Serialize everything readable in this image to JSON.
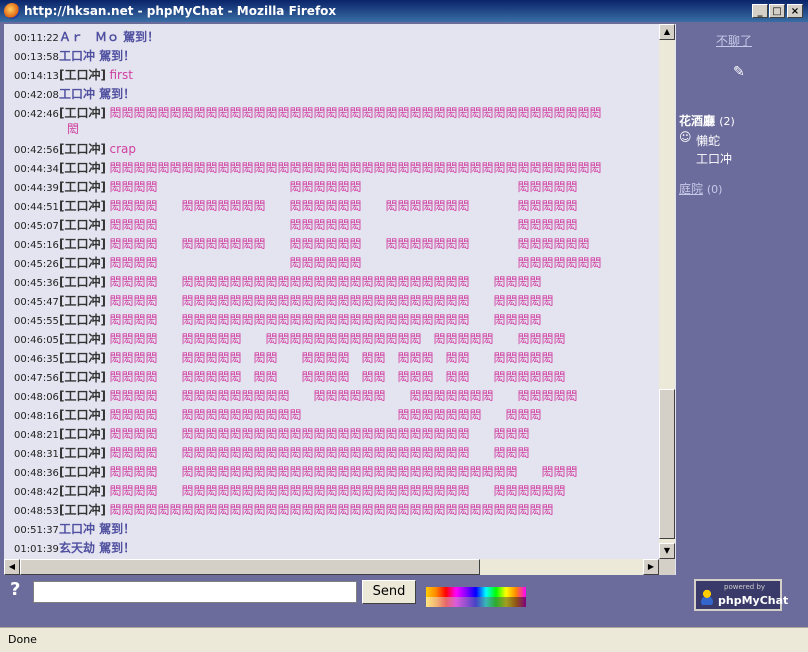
{
  "window": {
    "title": "http://hksan.net - phpMyChat - Mozilla Firefox"
  },
  "messages": [
    {
      "time": "00:11:22",
      "sys": "Ａｒ　Ｍｏ 駕到！"
    },
    {
      "time": "00:13:58",
      "sys": "工口冲 駕到！"
    },
    {
      "time": "00:14:13",
      "nick": "[工口冲]",
      "text": "first"
    },
    {
      "time": "00:42:08",
      "sys": "工口冲 駕到！"
    },
    {
      "time": "00:42:46",
      "nick": "[工口冲]",
      "text": "閎閎閎閎閎閎閎閎閎閎閎閎閎閎閎閎閎閎閎閎閎閎閎閎閎閎閎閎閎閎閎閎閎閎閎閎閎閎閎閎閎",
      "text2": "閎"
    },
    {
      "time": "00:42:56",
      "nick": "[工口冲]",
      "text": "crap"
    },
    {
      "time": "00:44:34",
      "nick": "[工口冲]",
      "text": "閎閎閎閎閎閎閎閎閎閎閎閎閎閎閎閎閎閎閎閎閎閎閎閎閎閎閎閎閎閎閎閎閎閎閎閎閎閎閎閎閎"
    },
    {
      "time": "00:44:39",
      "nick": "[工口冲]",
      "text": "閎閎閎閎　　　　　　　　　　　閎閎閎閎閎閎　　　　　　　　　　　　　閎閎閎閎閎"
    },
    {
      "time": "00:44:51",
      "nick": "[工口冲]",
      "text": "閎閎閎閎　　閎閎閎閎閎閎閎　　閎閎閎閎閎閎　　閎閎閎閎閎閎閎　　　　閎閎閎閎閎"
    },
    {
      "time": "00:45:07",
      "nick": "[工口冲]",
      "text": "閎閎閎閎　　　　　　　　　　　閎閎閎閎閎閎　　　　　　　　　　　　　閎閎閎閎閎"
    },
    {
      "time": "00:45:16",
      "nick": "[工口冲]",
      "text": "閎閎閎閎　　閎閎閎閎閎閎閎　　閎閎閎閎閎閎　　閎閎閎閎閎閎閎　　　　閎閎閎閎閎閎"
    },
    {
      "time": "00:45:26",
      "nick": "[工口冲]",
      "text": "閎閎閎閎　　　　　　　　　　　閎閎閎閎閎閎　　　　　　　　　　　　　閎閎閎閎閎閎閎"
    },
    {
      "time": "00:45:36",
      "nick": "[工口冲]",
      "text": "閎閎閎閎　　閎閎閎閎閎閎閎閎閎閎閎閎閎閎閎閎閎閎閎閎閎閎閎閎　　閎閎閎閎"
    },
    {
      "time": "00:45:47",
      "nick": "[工口冲]",
      "text": "閎閎閎閎　　閎閎閎閎閎閎閎閎閎閎閎閎閎閎閎閎閎閎閎閎閎閎閎閎　　閎閎閎閎閎"
    },
    {
      "time": "00:45:55",
      "nick": "[工口冲]",
      "text": "閎閎閎閎　　閎閎閎閎閎閎閎閎閎閎閎閎閎閎閎閎閎閎閎閎閎閎閎閎　　閎閎閎閎"
    },
    {
      "time": "00:46:05",
      "nick": "[工口冲]",
      "text": "閎閎閎閎　　閎閎閎閎閎　　閎閎閎閎閎閎閎閎閎閎閎閎閎　閎閎閎閎閎　　閎閎閎閎"
    },
    {
      "time": "00:46:35",
      "nick": "[工口冲]",
      "text": "閎閎閎閎　　閎閎閎閎閎　閎閎　　閎閎閎閎　閎閎　閎閎閎　閎閎　　閎閎閎閎閎"
    },
    {
      "time": "00:47:56",
      "nick": "[工口冲]",
      "text": "閎閎閎閎　　閎閎閎閎閎　閎閎　　閎閎閎閎　閎閎　閎閎閎　閎閎　　閎閎閎閎閎閎"
    },
    {
      "time": "00:48:06",
      "nick": "[工口冲]",
      "text": "閎閎閎閎　　閎閎閎閎閎閎閎閎閎　　閎閎閎閎閎閎　　閎閎閎閎閎閎閎　　閎閎閎閎閎"
    },
    {
      "time": "00:48:16",
      "nick": "[工口冲]",
      "text": "閎閎閎閎　　閎閎閎閎閎閎閎閎閎閎　　　　　　　　閎閎閎閎閎閎閎　　閎閎閎"
    },
    {
      "time": "00:48:21",
      "nick": "[工口冲]",
      "text": "閎閎閎閎　　閎閎閎閎閎閎閎閎閎閎閎閎閎閎閎閎閎閎閎閎閎閎閎閎　　閎閎閎"
    },
    {
      "time": "00:48:31",
      "nick": "[工口冲]",
      "text": "閎閎閎閎　　閎閎閎閎閎閎閎閎閎閎閎閎閎閎閎閎閎閎閎閎閎閎閎閎　　閎閎閎"
    },
    {
      "time": "00:48:36",
      "nick": "[工口冲]",
      "text": "閎閎閎閎　　閎閎閎閎閎閎閎閎閎閎閎閎閎閎閎閎閎閎閎閎閎閎閎閎閎閎閎閎　　閎閎閎"
    },
    {
      "time": "00:48:42",
      "nick": "[工口冲]",
      "text": "閎閎閎閎　　閎閎閎閎閎閎閎閎閎閎閎閎閎閎閎閎閎閎閎閎閎閎閎閎　　閎閎閎閎閎閎"
    },
    {
      "time": "00:48:53",
      "nick": "[工口冲]",
      "text": "閎閎閎閎閎閎閎閎閎閎閎閎閎閎閎閎閎閎閎閎閎閎閎閎閎閎閎閎閎閎閎閎閎閎閎閎閎"
    },
    {
      "time": "00:51:37",
      "sys": "工口冲 駕到！"
    },
    {
      "time": "01:01:39",
      "sys": "玄天劫 駕到！"
    }
  ],
  "sidebar": {
    "leave_label": "不聊了",
    "room1": {
      "name": "花酒廳",
      "count": "(2)",
      "users": [
        "懶蛇",
        "工口冲"
      ]
    },
    "room2": {
      "name": "庭院",
      "count": "(0)"
    }
  },
  "input": {
    "send_label": "Send",
    "help_label": "?"
  },
  "logo": {
    "small": "powered by",
    "big": "phpMyChat"
  },
  "status": {
    "text": "Done"
  },
  "colors": {
    "frame": "#6b6b9c",
    "chat_bg": "#e4e4f0",
    "msg_text": "#d040a0",
    "system_text": "#5050a0"
  }
}
